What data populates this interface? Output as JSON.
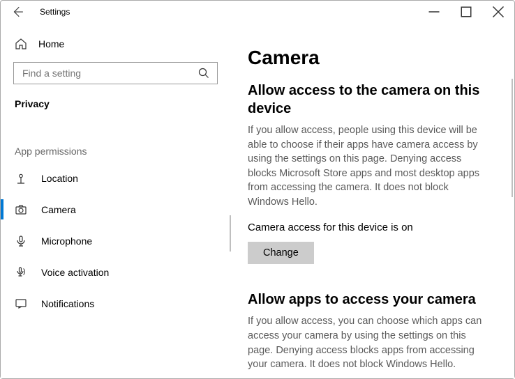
{
  "window": {
    "title": "Settings"
  },
  "sidebar": {
    "home_label": "Home",
    "search_placeholder": "Find a setting",
    "category": "Privacy",
    "group_label": "App permissions",
    "items": [
      {
        "label": "Location"
      },
      {
        "label": "Camera"
      },
      {
        "label": "Microphone"
      },
      {
        "label": "Voice activation"
      },
      {
        "label": "Notifications"
      }
    ]
  },
  "main": {
    "title": "Camera",
    "section1": {
      "heading": "Allow access to the camera on this device",
      "desc": "If you allow access, people using this device will be able to choose if their apps have camera access by using the settings on this page. Denying access blocks Microsoft Store apps and most desktop apps from accessing the camera. It does not block Windows Hello.",
      "status": "Camera access for this device is on",
      "change_label": "Change"
    },
    "section2": {
      "heading": "Allow apps to access your camera",
      "desc": "If you allow access, you can choose which apps can access your camera by using the settings on this page. Denying access blocks apps from accessing your camera. It does not block Windows Hello."
    }
  }
}
